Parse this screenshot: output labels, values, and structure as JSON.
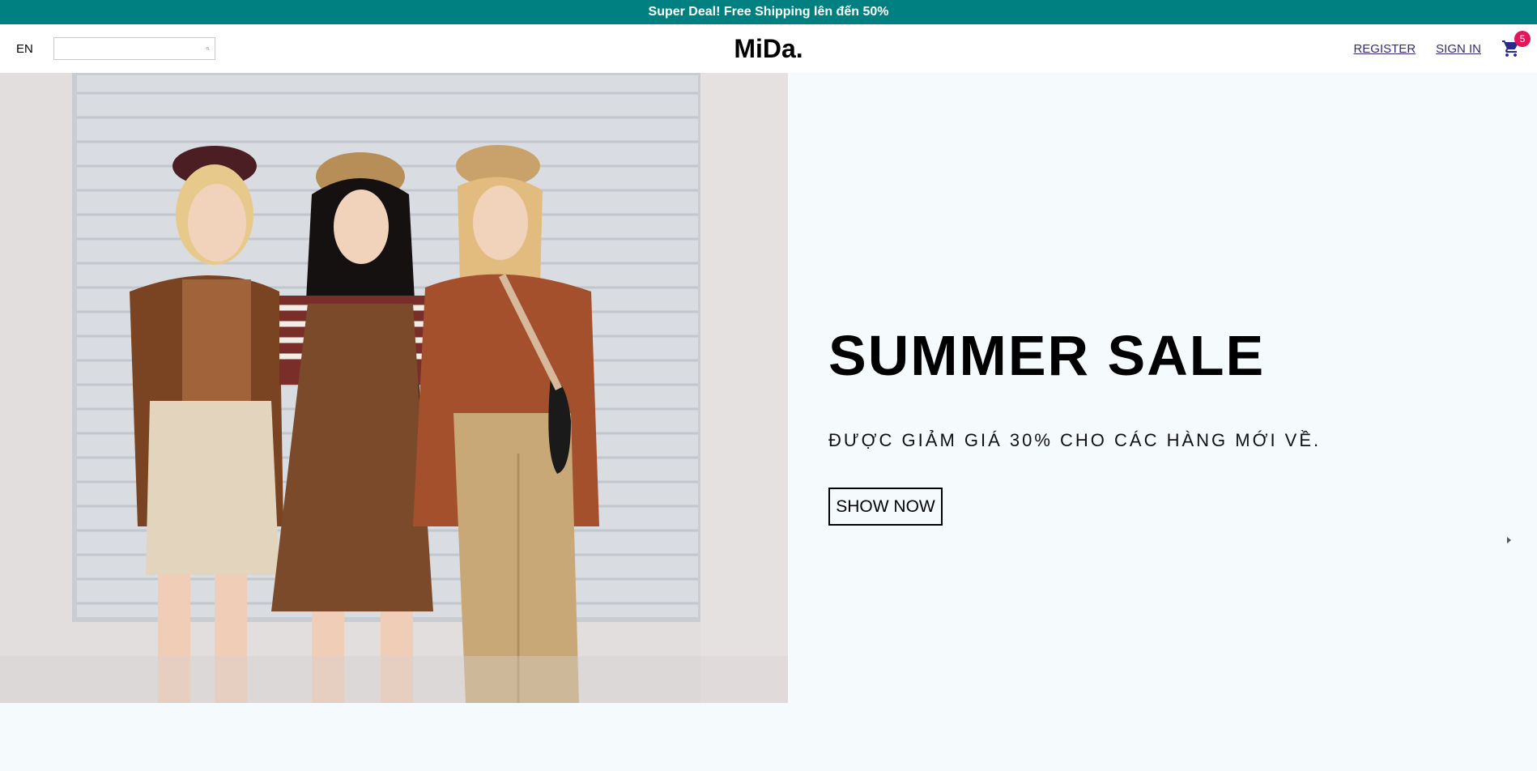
{
  "announcement": {
    "text": "Super Deal! Free Shipping lên đến 50%"
  },
  "navbar": {
    "language": "EN",
    "search": {
      "value": "",
      "placeholder": "",
      "icon": "search-icon"
    },
    "logo": "MiDa.",
    "register": "REGISTER",
    "sign_in": "SIGN IN",
    "cart": {
      "icon": "shopping-cart-icon",
      "count": "5"
    }
  },
  "slider": {
    "slides": [
      {
        "title": "SUMMER SALE",
        "desc": "ĐƯỢC GIẢM GIÁ 30% CHO CÁC HÀNG MỚI VỀ.",
        "button": "SHOW NOW",
        "bg": "#f5fafd"
      }
    ],
    "prev_icon": "arrow-left-icon",
    "next_icon": "arrow-right-icon"
  },
  "colors": {
    "announcement_bg": "#008080",
    "badge": "#e3165b",
    "link": "#3a2a6e",
    "cart_icon": "#2a2a8a"
  }
}
